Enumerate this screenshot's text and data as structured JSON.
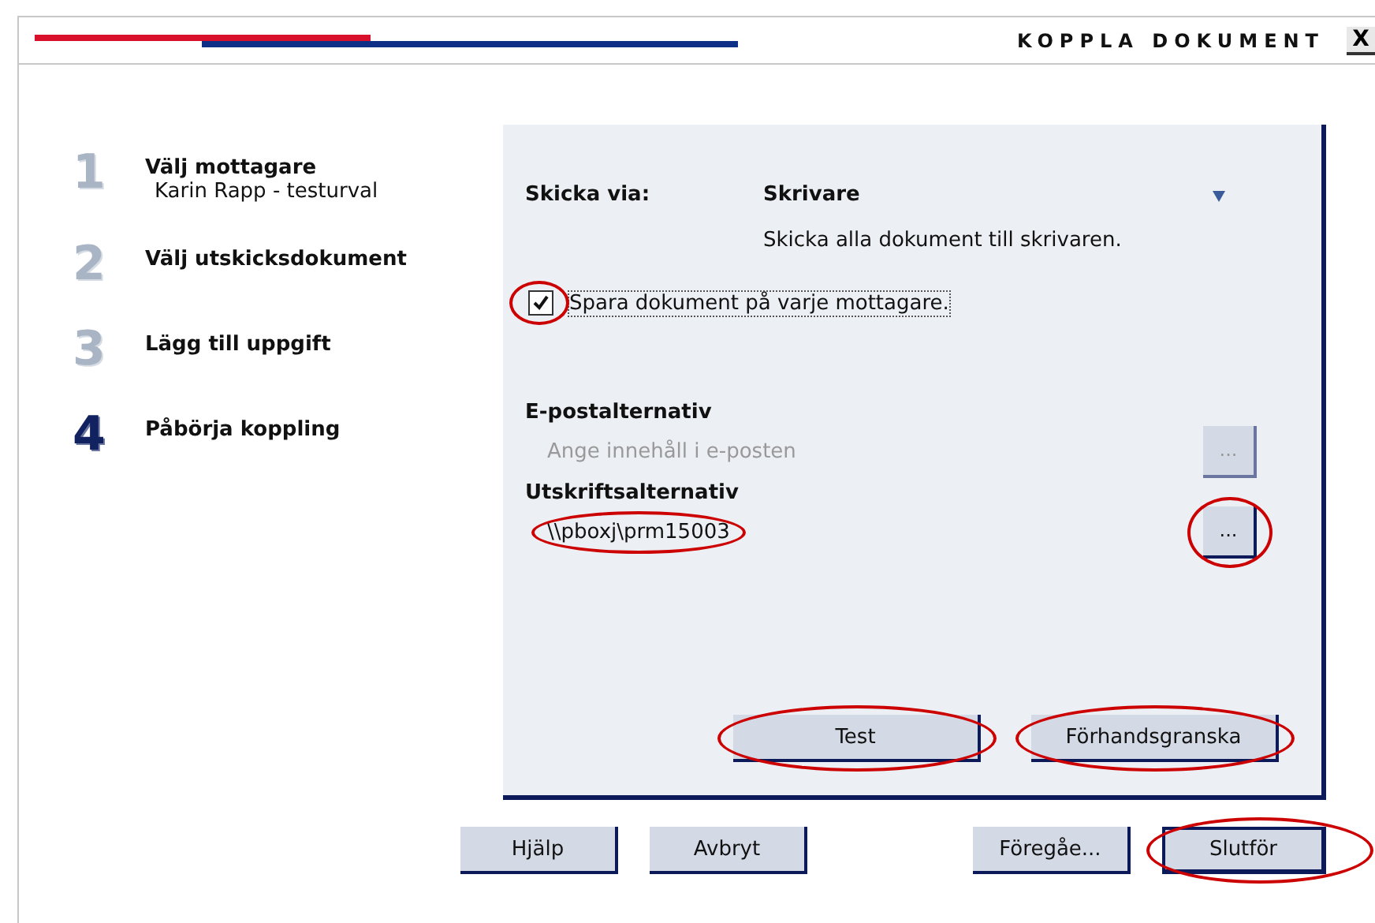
{
  "window": {
    "title": "KOPPLA DOKUMENT",
    "close": "X"
  },
  "steps": [
    {
      "number": "1",
      "title": "Välj mottagare",
      "subtitle": "Karin Rapp - testurval",
      "selected": false
    },
    {
      "number": "2",
      "title": "Välj utskicksdokument",
      "selected": false
    },
    {
      "number": "3",
      "title": "Lägg till uppgift",
      "selected": false
    },
    {
      "number": "4",
      "title": "Påbörja koppling",
      "selected": true
    }
  ],
  "send_via": {
    "label": "Skicka via:",
    "value": "Skrivare",
    "description": "Skicka alla dokument till skrivaren."
  },
  "save_option": {
    "label": "Spara dokument på varje mottagare.",
    "checked": true,
    "highlighted": true
  },
  "email_options": {
    "heading": "E-postalternativ",
    "value": "Ange innehåll i e-posten",
    "disabled": true,
    "button": "..."
  },
  "print_options": {
    "heading": "Utskriftsalternativ",
    "value": "\\\\pboxj\\prm15003",
    "value_highlighted": true,
    "disabled": false,
    "button": "...",
    "button_highlighted": true
  },
  "panel_buttons": [
    {
      "label": "Test",
      "highlighted": true
    },
    {
      "label": "Förhandsgranska",
      "highlighted": true
    }
  ],
  "footer_buttons": [
    {
      "label": "Hjälp",
      "default": false,
      "highlighted": false
    },
    {
      "label": "Avbryt",
      "default": false,
      "highlighted": false
    },
    {
      "label": "Föregåe...",
      "default": false,
      "highlighted": false
    },
    {
      "label": "Slutför",
      "default": true,
      "highlighted": true
    }
  ]
}
